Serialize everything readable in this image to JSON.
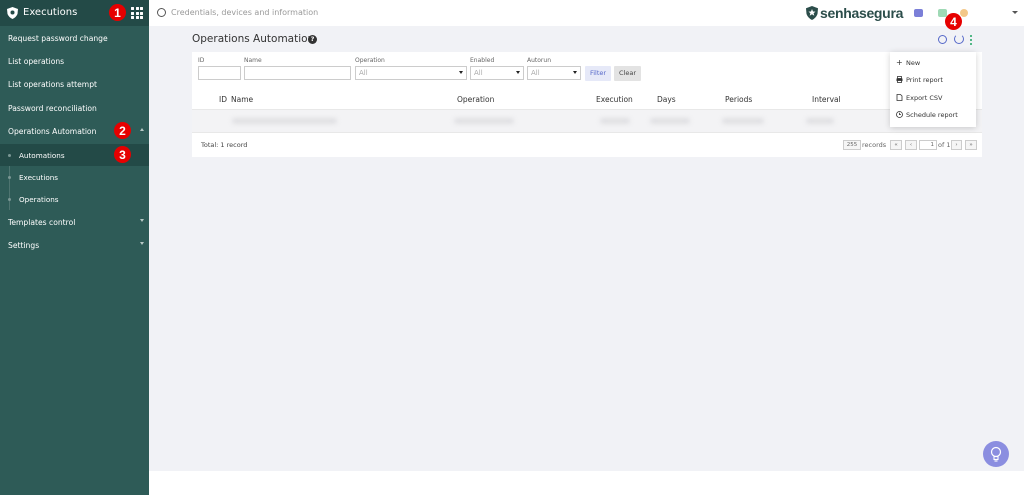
{
  "sidebar": {
    "title": "Executions",
    "items": [
      {
        "label": "Request password change"
      },
      {
        "label": "List operations"
      },
      {
        "label": "List operations attempt"
      },
      {
        "label": "Password reconciliation"
      },
      {
        "label": "Operations Automation"
      },
      {
        "label": "Automations"
      },
      {
        "label": "Executions"
      },
      {
        "label": "Operations"
      },
      {
        "label": "Templates control"
      },
      {
        "label": "Settings"
      }
    ]
  },
  "annotations": [
    "1",
    "2",
    "3",
    "4"
  ],
  "header": {
    "search_placeholder": "Credentials, devices and information",
    "brand": "senhasegura"
  },
  "page": {
    "title": "Operations Automation"
  },
  "filters": {
    "id_label": "ID",
    "name_label": "Name",
    "operation_label": "Operation",
    "operation_value": "All",
    "enabled_label": "Enabled",
    "enabled_value": "All",
    "autorun_label": "Autorun",
    "autorun_value": "All",
    "filter_button": "Filter",
    "clear_button": "Clear"
  },
  "table": {
    "columns": [
      "ID",
      "Name",
      "Operation",
      "Execution",
      "Days",
      "Periods",
      "Interval"
    ],
    "total": "Total: 1 record"
  },
  "pagination": {
    "per_page": "255",
    "records_label": "records",
    "first": "«",
    "prev": "‹",
    "page": "1",
    "of": "of 1",
    "next": "›",
    "last": "»"
  },
  "menu": {
    "items": [
      "New",
      "Print report",
      "Export CSV",
      "Schedule report"
    ]
  },
  "colors": {
    "sidebar_bg": "#2e5b57",
    "accent": "#5568c9",
    "badge": "#e60000"
  }
}
